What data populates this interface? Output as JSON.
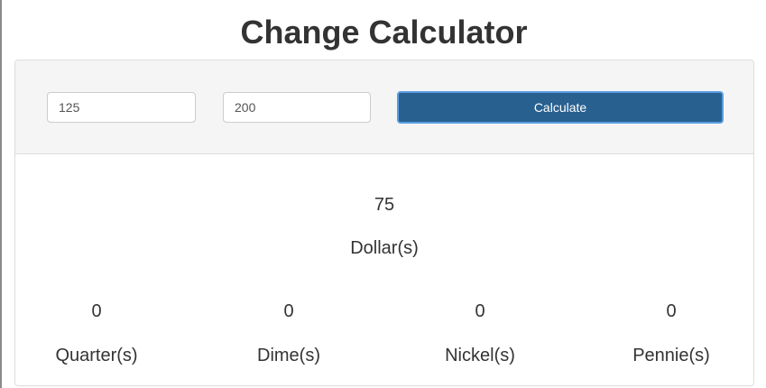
{
  "page": {
    "title": "Change Calculator"
  },
  "form": {
    "cost_value": "125",
    "paid_value": "200",
    "calculate_label": "Calculate"
  },
  "results": {
    "dollars": {
      "value": "75",
      "label": "Dollar(s)"
    },
    "coins": [
      {
        "value": "0",
        "label": "Quarter(s)"
      },
      {
        "value": "0",
        "label": "Dime(s)"
      },
      {
        "value": "0",
        "label": "Nickel(s)"
      },
      {
        "value": "0",
        "label": "Pennie(s)"
      }
    ]
  },
  "colors": {
    "button_bg": "#286090",
    "button_border": "#5b9ee0",
    "panel_heading_bg": "#f5f5f5",
    "text": "#333333"
  }
}
